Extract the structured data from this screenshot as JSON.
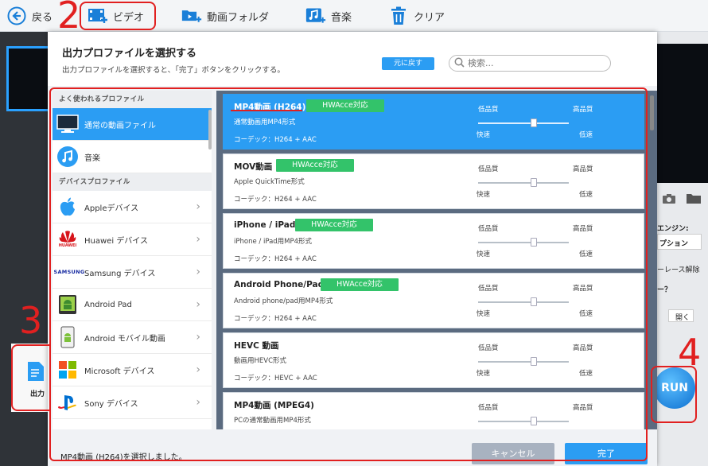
{
  "toolbar": {
    "back": "戻る",
    "video": "ビデオ",
    "folder": "動画フォルダ",
    "music": "音楽",
    "clear": "クリア"
  },
  "dialog": {
    "title": "出力プロファイルを選択する",
    "subtitle": "出力プロファイルを選択すると、「完了」ボタンをクリックする。",
    "reset": "元に戻す",
    "search_placeholder": "検索..."
  },
  "left": {
    "section1": "よく使われるプロファイル",
    "section2": "デバイスプロファイル",
    "items": [
      {
        "label": "通常の動画ファイル"
      },
      {
        "label": "音楽"
      },
      {
        "label": "Appleデバイス"
      },
      {
        "label": "Huawei デバイス"
      },
      {
        "label": "Samsung デバイス"
      },
      {
        "label": "Android Pad"
      },
      {
        "label": "Android モバイル動画"
      },
      {
        "label": "Microsoft デバイス"
      },
      {
        "label": "Sony デバイス"
      }
    ],
    "huawei_logo": "HUAWEI",
    "samsung_logo": "SAMSUNG"
  },
  "quality": {
    "low": "低品質",
    "high": "高品質",
    "fast": "快速",
    "slow": "低速"
  },
  "profiles": [
    {
      "name": "MP4動画 (H264)",
      "hw": "HWAcce対応",
      "desc": "通常動画用MP4形式",
      "codec": "コーデック：H264 + AAC"
    },
    {
      "name": "MOV動画",
      "hw": "HWAcce対応",
      "desc": "Apple QuickTime形式",
      "codec": "コーデック：H264 + AAC"
    },
    {
      "name": "iPhone / iPad",
      "hw": "HWAcce対応",
      "desc": "iPhone / iPad用MP4形式",
      "codec": "コーデック：H264 + AAC"
    },
    {
      "name": "Android Phone/Pad",
      "hw": "HWAcce対応",
      "desc": "Android phone/pad用MP4形式",
      "codec": "コーデック：H264 + AAC"
    },
    {
      "name": "HEVC 動画",
      "hw": "",
      "desc": "動画用HEVC形式",
      "codec": "コーデック：HEVC + AAC"
    },
    {
      "name": "MP4動画 (MPEG4)",
      "hw": "",
      "desc": "PCの通常動画用MP4形式",
      "codec": ""
    }
  ],
  "footer": {
    "status": "MP4動画 (H264)を選択しました。",
    "cancel": "キャンセル",
    "done": "完了"
  },
  "background": {
    "engine": "エンジン:",
    "option": "プション",
    "interlace": "ーレース解除",
    "question": "ー？",
    "open": "開く",
    "output": "出力",
    "run": "RUN"
  },
  "annotations": [
    "2",
    "3",
    "4"
  ],
  "colors": {
    "accent": "#2b9df3",
    "hw": "#33c36a",
    "annotation": "#e12020"
  }
}
